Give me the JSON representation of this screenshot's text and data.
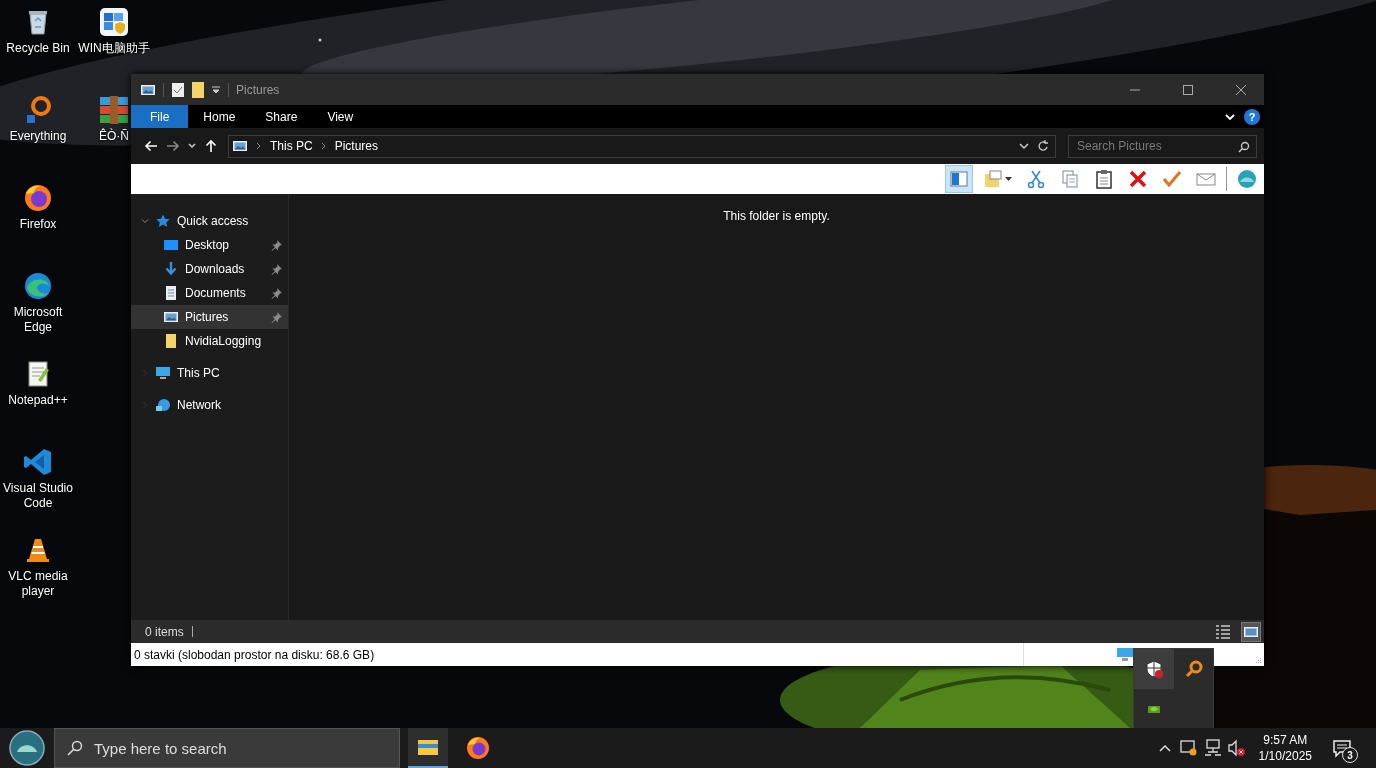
{
  "desktop_icons": [
    {
      "label": "Recycle Bin",
      "kind": "recycle-bin"
    },
    {
      "label": "Everything",
      "kind": "everything"
    },
    {
      "label": "Firefox",
      "kind": "firefox"
    },
    {
      "label": "Microsoft Edge",
      "kind": "edge"
    },
    {
      "label": "Notepad++",
      "kind": "notepad"
    },
    {
      "label": "Visual Studio Code",
      "kind": "vscode"
    },
    {
      "label": "VLC media player",
      "kind": "vlc"
    },
    {
      "label": "WIN电脑助手",
      "kind": "win-helper"
    },
    {
      "label": "ÊÒ·Ñ",
      "kind": "archive"
    }
  ],
  "window": {
    "title": "Pictures",
    "ribbon_tabs": [
      {
        "label": "File",
        "selected": true
      },
      {
        "label": "Home",
        "selected": false
      },
      {
        "label": "Share",
        "selected": false
      },
      {
        "label": "View",
        "selected": false
      }
    ],
    "help": "?",
    "address": {
      "breadcrumbs": [
        "This PC",
        "Pictures"
      ]
    },
    "search": {
      "placeholder": "Search Pictures"
    },
    "toolbar": [
      {
        "kind": "preview-pane",
        "selected": true
      },
      {
        "kind": "folder-view",
        "selected": false
      },
      {
        "kind": "cut",
        "selected": false
      },
      {
        "kind": "copy",
        "selected": false
      },
      {
        "kind": "paste",
        "selected": false
      },
      {
        "kind": "delete",
        "selected": false
      },
      {
        "kind": "check",
        "selected": false
      },
      {
        "kind": "mail",
        "selected": false
      },
      {
        "kind": "globe",
        "selected": false
      }
    ],
    "navigation_pane": [
      {
        "label": "Quick access",
        "kind": "star",
        "expanded": true,
        "selected": false,
        "children": [
          {
            "label": "Desktop",
            "kind": "desktop",
            "pinned": true,
            "selected": false
          },
          {
            "label": "Downloads",
            "kind": "downloads",
            "pinned": true,
            "selected": false
          },
          {
            "label": "Documents",
            "kind": "documents",
            "pinned": true,
            "selected": false
          },
          {
            "label": "Pictures",
            "kind": "pictures",
            "pinned": true,
            "selected": true
          },
          {
            "label": "NvidiaLogging",
            "kind": "folder",
            "pinned": false,
            "selected": false
          }
        ]
      },
      {
        "label": "This PC",
        "kind": "pc",
        "expanded": false,
        "selected": false
      },
      {
        "label": "Network",
        "kind": "network",
        "expanded": false,
        "selected": false
      }
    ],
    "content": {
      "message": "This folder is empty."
    },
    "status_bar": {
      "items": "0 items",
      "views": [
        {
          "kind": "details",
          "selected": false
        },
        {
          "kind": "large-icons",
          "selected": true
        }
      ]
    },
    "info_bar": {
      "text": "0 stavki (slobodan prostor na disku: 68.6 GB)"
    }
  },
  "tray_overflow": [
    {
      "kind": "shield",
      "selected": true
    },
    {
      "kind": "magnifier",
      "selected": false
    },
    {
      "kind": "nvidia",
      "selected": false
    }
  ],
  "taskbar": {
    "search": {
      "placeholder": "Type here to search"
    },
    "apps": [
      {
        "kind": "explorer",
        "active": true
      },
      {
        "kind": "firefox",
        "active": false
      }
    ],
    "tray": [
      {
        "kind": "update"
      },
      {
        "kind": "network"
      },
      {
        "kind": "volume-muted"
      }
    ],
    "time": "9:57 AM",
    "date": "1/10/2025",
    "notifications": "3"
  }
}
